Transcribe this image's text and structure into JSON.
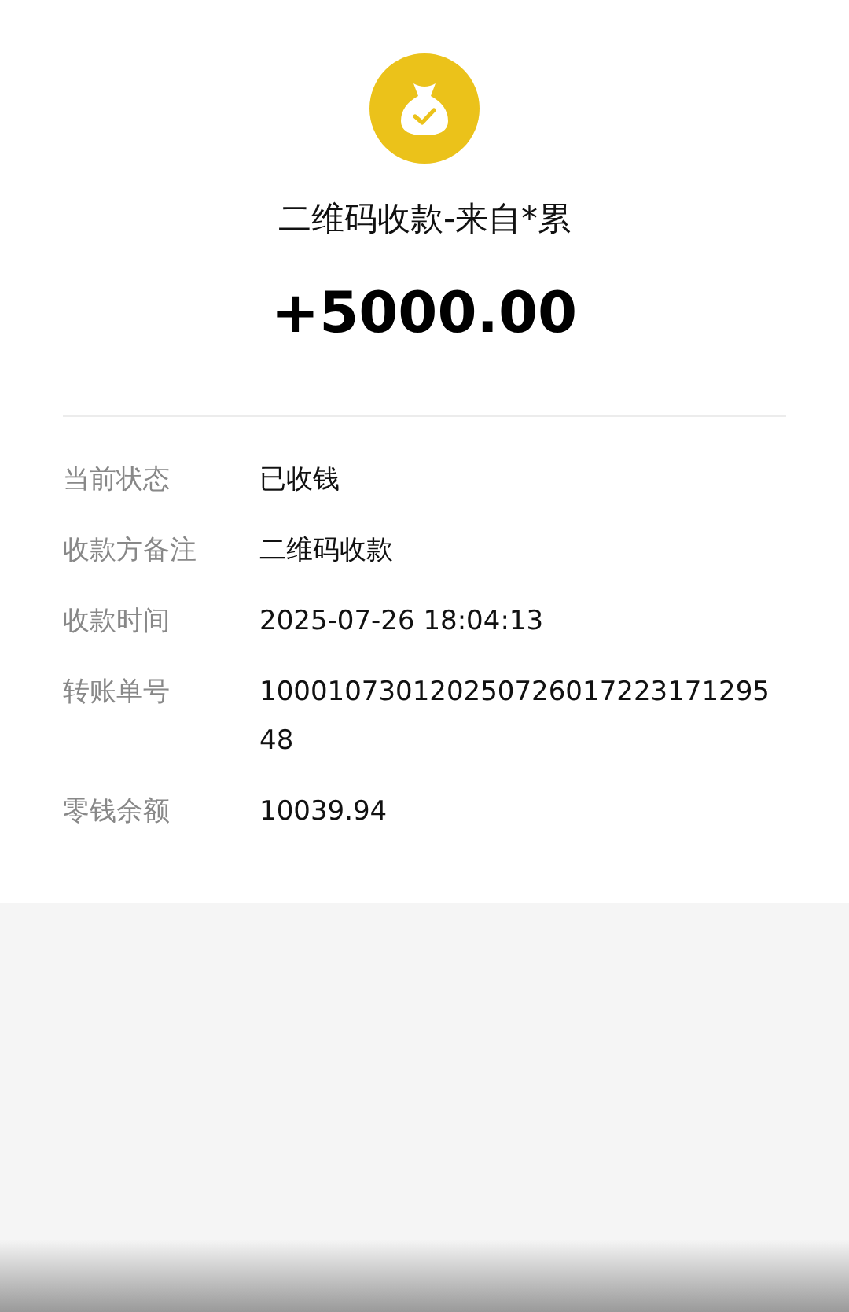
{
  "header": {
    "title": "二维码收款-来自*累",
    "amount": "+5000.00"
  },
  "details": [
    {
      "label": "当前状态",
      "value": "已收钱"
    },
    {
      "label": "收款方备注",
      "value": "二维码收款"
    },
    {
      "label": "收款时间",
      "value": "2025-07-26 18:04:13"
    },
    {
      "label": "转账单号",
      "value": "100010730120250726017223171295 48"
    },
    {
      "label": "零钱余额",
      "value": "10039.94"
    }
  ]
}
